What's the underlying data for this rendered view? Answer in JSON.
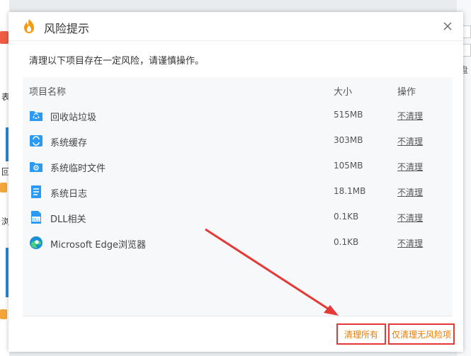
{
  "dialog": {
    "title": "风险提示",
    "close_glyph": "✕",
    "warning": "清理以下项目存在一定风险，请谨慎操作。"
  },
  "table": {
    "headers": {
      "name": "项目名称",
      "size": "大小",
      "op": "操作"
    },
    "rows": [
      {
        "icon": "recycle-bin-icon",
        "name": "回收站垃圾",
        "size": "515MB",
        "op": "不清理"
      },
      {
        "icon": "system-cache-icon",
        "name": "系统缓存",
        "size": "303MB",
        "op": "不清理"
      },
      {
        "icon": "temp-files-icon",
        "name": "系统临时文件",
        "size": "105MB",
        "op": "不清理"
      },
      {
        "icon": "system-log-icon",
        "name": "系统日志",
        "size": "18.1MB",
        "op": "不清理"
      },
      {
        "icon": "dll-icon",
        "name": "DLL相关",
        "size": "0.1KB",
        "op": "不清理"
      },
      {
        "icon": "edge-icon",
        "name": "Microsoft Edge浏览器",
        "size": "0.1KB",
        "op": "不清理"
      }
    ]
  },
  "buttons": {
    "clean_all": "清理所有",
    "clean_safe": "仅清理无风险项"
  },
  "colors": {
    "accent": "#e87c00",
    "highlight": "#e53935",
    "icon_blue": "#2b9af3"
  },
  "background": {
    "fragments": [
      "表",
      "回",
      "浏",
      "盘"
    ]
  }
}
